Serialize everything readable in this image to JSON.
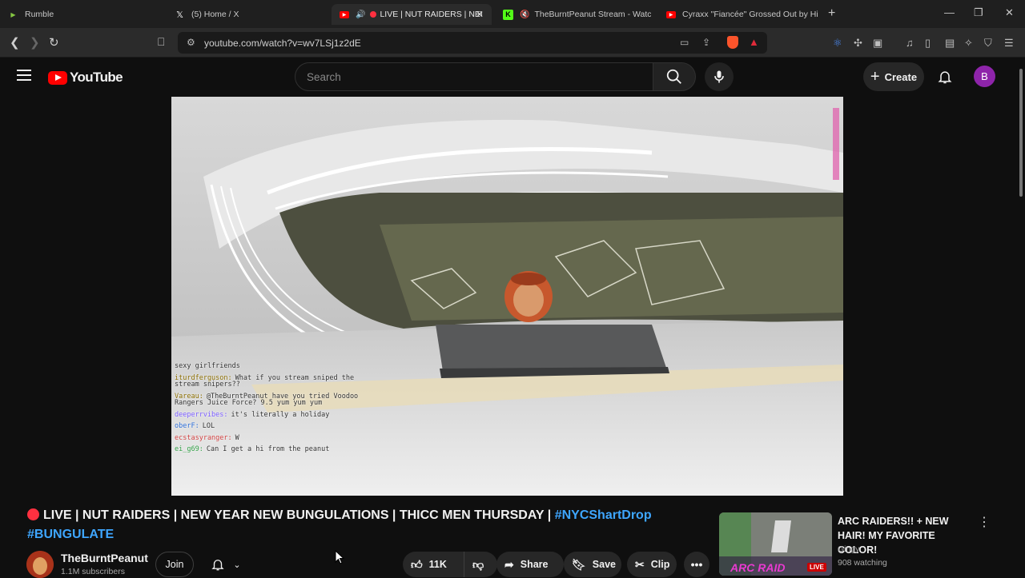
{
  "browser": {
    "tabs": [
      {
        "title": "Rumble",
        "icon": "rumble-icon"
      },
      {
        "title": "(5) Home / X",
        "icon": "x-icon"
      },
      {
        "title": "LIVE | NUT RAIDERS | NEW",
        "icon": "youtube-icon",
        "active": true
      },
      {
        "title": "TheBurntPeanut Stream - Watch",
        "icon": "kick-icon"
      },
      {
        "title": "Cyraxx \"Fiancée\" Grossed Out by His",
        "icon": "youtube-icon"
      }
    ],
    "url": "youtube.com/watch?v=wv7LSj1z2dE"
  },
  "youtube": {
    "logo_text": "YouTube",
    "search_placeholder": "Search",
    "create_label": "Create",
    "avatar_letter": "B"
  },
  "chat": [
    {
      "user": "",
      "text": "sexy girlfriends",
      "color": "#555555"
    },
    {
      "user": "iturdferguson:",
      "text": "What if you stream sniped the stream snipers??",
      "color": "#8a6d00"
    },
    {
      "user": "Vareau:",
      "text": "@TheBurntPeanut have you tried Voodoo Rangers Juice Force? 9.5 yum yum yum",
      "color": "#8a6d00"
    },
    {
      "user": "deeperrvibes:",
      "text": "it's literally a holiday",
      "color": "#7a5cff"
    },
    {
      "user": "oberF:",
      "text": "LOL",
      "color": "#2b6cd6"
    },
    {
      "user": "ecstasyranger:",
      "text": "W",
      "color": "#d04040"
    },
    {
      "user": "ei_g69:",
      "text": "Can I get a hi from the peanut",
      "color": "#2f9e44"
    }
  ],
  "video": {
    "title_main": "LIVE | NUT RAIDERS | NEW YEAR NEW BUNGULATIONS | THICC MEN THURSDAY | ",
    "hashtag1": "#NYCShartDrop",
    "hashtag2": "#BUNGULATE",
    "channel": "TheBurntPeanut",
    "subscribers": "1.1M subscribers",
    "join_label": "Join",
    "likes": "11K",
    "share_label": "Share",
    "save_label": "Save",
    "clip_label": "Clip"
  },
  "recommendation": {
    "title": "ARC RAIDERS!! + NEW HAIR! MY FAVORITE COLOR!",
    "channel": "Gingy",
    "watching": "908 watching",
    "badge": "LIVE",
    "thumb_text": "ARC RAID"
  }
}
